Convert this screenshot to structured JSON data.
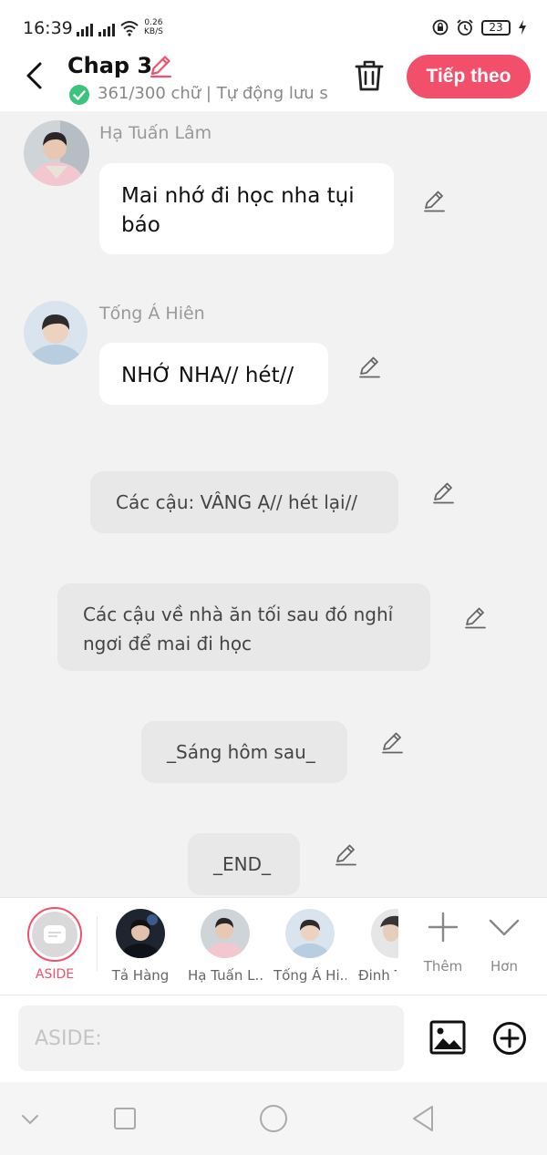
{
  "status_bar": {
    "time": "16:39",
    "speed_value": "0.26",
    "speed_unit": "KB/S",
    "battery": "23"
  },
  "header": {
    "title": "Chap 3",
    "subtitle": "361/300 chữ | Tự động lưu s",
    "next_label": "Tiếp theo"
  },
  "messages": [
    {
      "type": "character",
      "speaker": "Hạ Tuấn Lâm",
      "text_lines": [
        "Mai nhớ đi học nha tụi",
        "báo"
      ],
      "avatar": "ha-tuan-lam-avatar"
    },
    {
      "type": "character",
      "speaker": "Tống Á Hiên",
      "text_lines": [
        "NHỚ NHA// hét//"
      ],
      "avatar": "tong-a-hien-avatar"
    },
    {
      "type": "aside",
      "text_lines": [
        "Các cậu: VÂNG Ạ// hét lại//"
      ]
    },
    {
      "type": "aside",
      "text_lines": [
        "Các cậu về nhà ăn tối sau đó nghỉ",
        "ngơi để mai đi học"
      ]
    },
    {
      "type": "aside",
      "text_lines": [
        "_Sáng hôm sau_"
      ]
    },
    {
      "type": "aside",
      "text_lines": [
        "_END_"
      ]
    }
  ],
  "character_bar": {
    "aside_label": "ASIDE",
    "characters": [
      {
        "name": "Tả Hàng"
      },
      {
        "name": "Hạ Tuấn L..."
      },
      {
        "name": "Tống Á Hi..."
      },
      {
        "name": "Đinh T"
      }
    ],
    "more_label": "Thêm",
    "less_label": "Hơn"
  },
  "input": {
    "placeholder": "ASIDE:"
  },
  "colors": {
    "accent": "#f2506a",
    "check": "#3cc47c",
    "background": "#f2f2f2"
  }
}
